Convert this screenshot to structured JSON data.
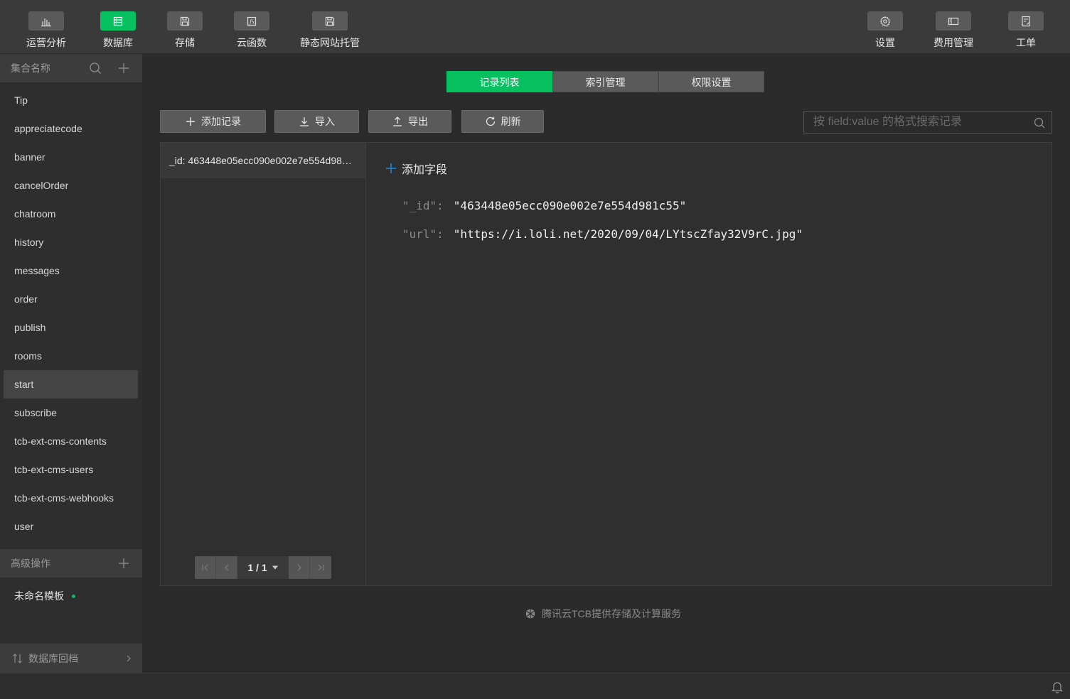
{
  "toolbar": {
    "left": [
      {
        "label": "运营分析",
        "icon": "bar-chart-icon"
      },
      {
        "label": "数据库",
        "icon": "database-icon",
        "active": true
      },
      {
        "label": "存储",
        "icon": "storage-icon"
      },
      {
        "label": "云函数",
        "icon": "function-icon"
      },
      {
        "label": "静态网站托管",
        "icon": "hosting-icon"
      }
    ],
    "right": [
      {
        "label": "设置",
        "icon": "gear-icon"
      },
      {
        "label": "费用管理",
        "icon": "billing-icon"
      },
      {
        "label": "工单",
        "icon": "ticket-icon"
      }
    ]
  },
  "sidebar": {
    "header": "集合名称",
    "collections": [
      "Tip",
      "appreciatecode",
      "banner",
      "cancelOrder",
      "chatroom",
      "history",
      "messages",
      "order",
      "publish",
      "rooms",
      "start",
      "subscribe",
      "tcb-ext-cms-contents",
      "tcb-ext-cms-users",
      "tcb-ext-cms-webhooks",
      "user"
    ],
    "selected": "start",
    "advanced_header": "高级操作",
    "template": "未命名模板",
    "rollback": "数据库回档"
  },
  "tabs": [
    "记录列表",
    "索引管理",
    "权限设置"
  ],
  "active_tab": "记录列表",
  "actions": {
    "add_record": "添加记录",
    "import": "导入",
    "export": "导出",
    "refresh": "刷新"
  },
  "search": {
    "placeholder": "按 field:value 的格式搜索记录"
  },
  "records": [
    {
      "label": "_id: 463448e05ecc090e002e7e554d981c55"
    }
  ],
  "pager": {
    "text": "1 / 1"
  },
  "detail": {
    "add_field": "添加字段",
    "fields": [
      {
        "key": "\"_id\":",
        "value": "\"463448e05ecc090e002e7e554d981c55\""
      },
      {
        "key": "\"url\":",
        "value": "\"https://i.loli.net/2020/09/04/LYtscZfay32V9rC.jpg\""
      }
    ]
  },
  "footer": "腾讯云TCB提供存储及计算服务",
  "colors": {
    "accent": "#07c160",
    "background": "#2b2b2b"
  }
}
